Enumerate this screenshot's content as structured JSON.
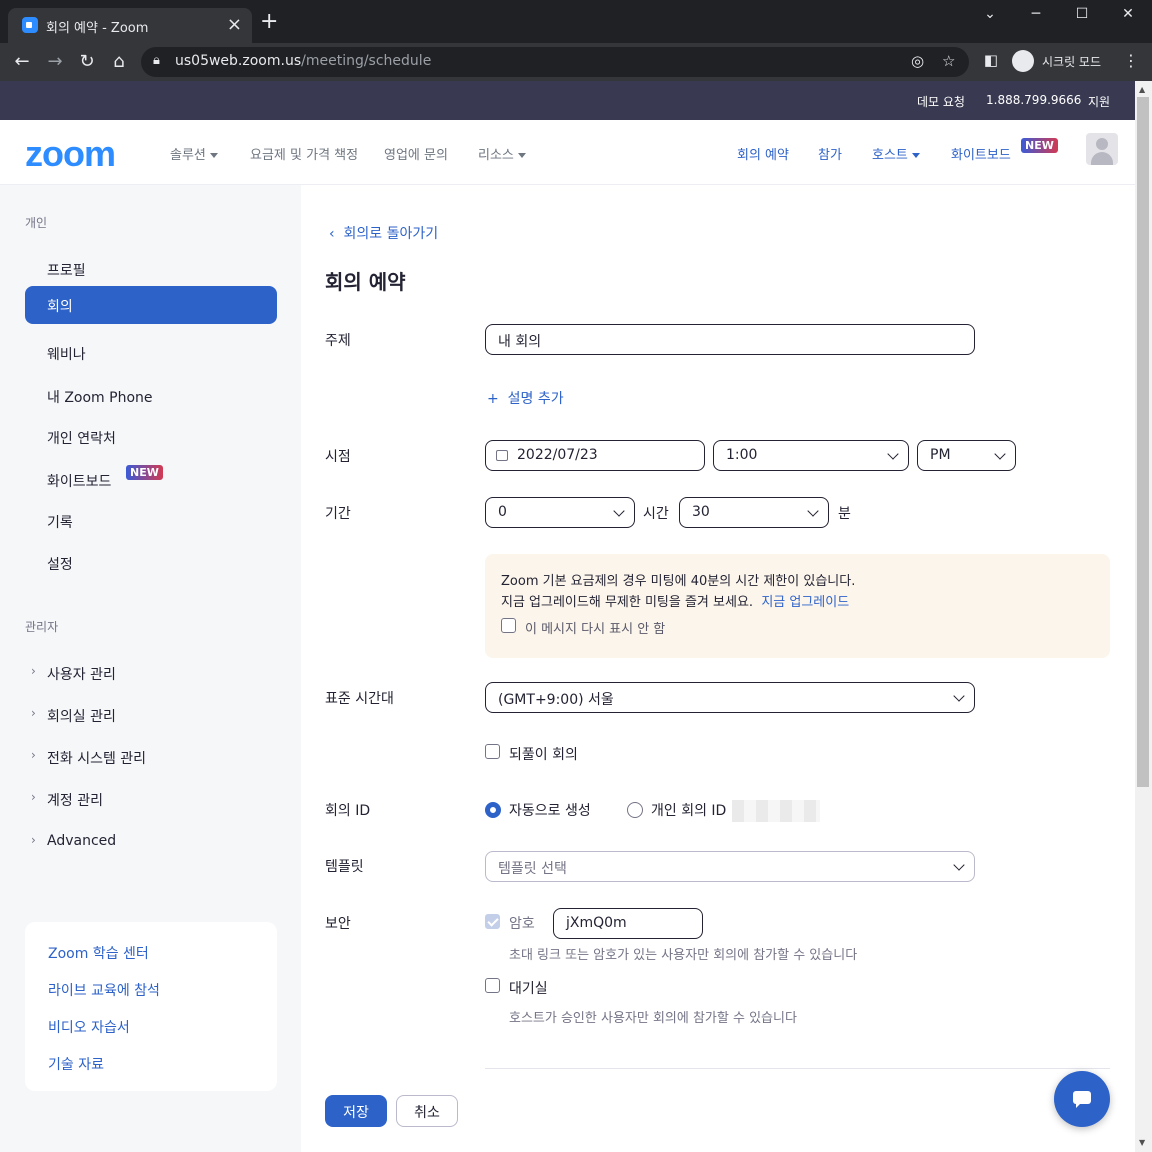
{
  "browser": {
    "tab_title": "회의 예약 - Zoom",
    "url_host": "us05web.zoom.us",
    "url_path": "/meeting/schedule",
    "incognito_label": "시크릿 모드"
  },
  "util_bar": {
    "demo": "데모 요청",
    "phone": "1.888.799.9666",
    "support": "지원"
  },
  "nav": {
    "logo": "zoom",
    "solutions": "솔루션",
    "pricing": "요금제 및 가격 책정",
    "contact_sales": "영업에 문의",
    "resources": "리소스",
    "schedule": "회의 예약",
    "join": "참가",
    "host": "호스트",
    "whiteboard": "화이트보드",
    "new_badge": "NEW"
  },
  "sidebar": {
    "personal_heading": "개인",
    "items": [
      "프로필",
      "회의",
      "웨비나",
      "내 Zoom Phone",
      "개인 연락처",
      "화이트보드",
      "기록",
      "설정"
    ],
    "whiteboard_badge": "NEW",
    "admin_heading": "관리자",
    "admin_items": [
      "사용자 관리",
      "회의실 관리",
      "전화 시스템 관리",
      "계정 관리",
      "Advanced"
    ],
    "card_links": [
      "Zoom 학습 센터",
      "라이브 교육에 참석",
      "비디오 자습서",
      "기술 자료"
    ]
  },
  "content": {
    "back_link": "회의로 돌아가기",
    "page_title": "회의 예약",
    "topic_label": "주제",
    "topic_value": "내 회의",
    "add_description": "설명 추가",
    "when_label": "시점",
    "date_value": "2022/07/23",
    "time_value": "1:00",
    "ampm_value": "PM",
    "duration_label": "기간",
    "duration_hours": "0",
    "hours_unit": "시간",
    "duration_minutes": "30",
    "minutes_unit": "분",
    "notice_line1": "Zoom 기본 요금제의 경우 미팅에 40분의 시간 제한이 있습니다.",
    "notice_line2": "지금 업그레이드해 무제한 미팅을 즐겨 보세요.",
    "notice_link": "지금 업그레이드",
    "notice_checkbox": "이 메시지 다시 표시 안 함",
    "timezone_label": "표준 시간대",
    "timezone_value": "(GMT+9:00) 서울",
    "recurring_label": "되풀이 회의",
    "meeting_id_label": "회의 ID",
    "auto_generate": "자동으로 생성",
    "personal_meeting_id": "개인 회의 ID",
    "template_label": "템플릿",
    "template_placeholder": "템플릿 선택",
    "security_label": "보안",
    "passcode_label": "암호",
    "passcode_value": "jXmQ0m",
    "passcode_hint": "초대 링크 또는 암호가 있는 사용자만 회의에 참가할 수 있습니다",
    "waiting_room_label": "대기실",
    "waiting_room_hint": "호스트가 승인한 사용자만 회의에 참가할 수 있습니다",
    "save_button": "저장",
    "cancel_button": "취소"
  },
  "colors": {
    "accent": "#2d62c9",
    "zoom_blue": "#2d8cff",
    "util_bar": "#393a52",
    "notice_bg": "#fcf5eb"
  }
}
